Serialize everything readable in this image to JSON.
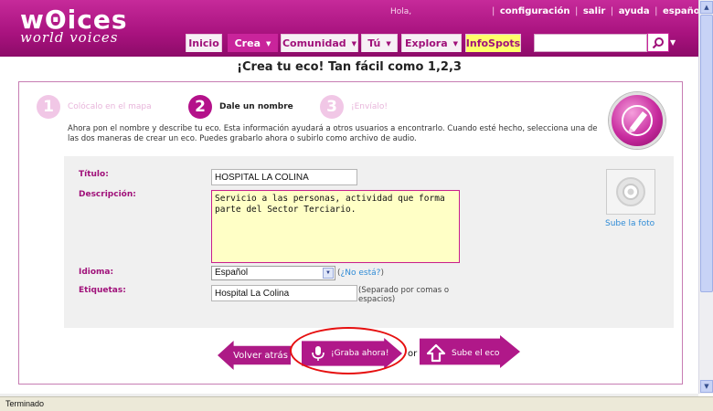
{
  "header": {
    "logo_main": "wꙨices",
    "logo_sub": "world voices",
    "greeting": "Hola,",
    "toplinks": [
      "configuración",
      "salir",
      "ayuda",
      "español ▼"
    ]
  },
  "nav": {
    "tabs": [
      {
        "label": "Inicio",
        "dropdown": false
      },
      {
        "label": "Crea",
        "dropdown": true,
        "active": true
      },
      {
        "label": "Comunidad",
        "dropdown": true
      },
      {
        "label": "Tú",
        "dropdown": true
      },
      {
        "label": "Explora",
        "dropdown": true
      },
      {
        "label": "InfoSpots",
        "dropdown": false
      }
    ],
    "search_value": ""
  },
  "page": {
    "title": "¡Crea tu eco! Tan fácil como 1,2,3"
  },
  "steps": [
    {
      "number": "1",
      "label": "Colócalo en el mapa",
      "state": "inactive"
    },
    {
      "number": "2",
      "label": "Dale un nombre",
      "state": "current"
    },
    {
      "number": "3",
      "label": "¡Envíalo!",
      "state": "inactive"
    }
  ],
  "instructions": "Ahora pon el nombre y describe tu eco. Esta información ayudará a otros usuarios a encontrarlo. Cuando esté hecho, selecciona una de las dos maneras de crear un eco. Puedes grabarlo ahora o subirlo como archivo de audio.",
  "form": {
    "titulo_label": "Título:",
    "titulo_value": "HOSPITAL LA COLINA",
    "descripcion_label": "Descripción:",
    "descripcion_value": "Servicio a las personas, actividad que forma parte del Sector Terciario.",
    "idioma_label": "Idioma:",
    "idioma_value": "Español",
    "no_esta_pre": "(",
    "no_esta_link": "¿No está?",
    "no_esta_post": ")",
    "etiquetas_label": "Etiquetas:",
    "etiquetas_value": "Hospital La Colina",
    "etiquetas_hint": "(Separado por comas o espacios)",
    "photo_link": "Sube la foto"
  },
  "actions": {
    "back": "Volver atrás",
    "record": "¡Graba ahora!",
    "or": "or",
    "upload": "Sube el eco"
  },
  "status": {
    "text": "Terminado"
  },
  "colors": {
    "brand": "#b4118a",
    "infospots": "#ffff6a",
    "highlight_ring": "#e61010"
  }
}
